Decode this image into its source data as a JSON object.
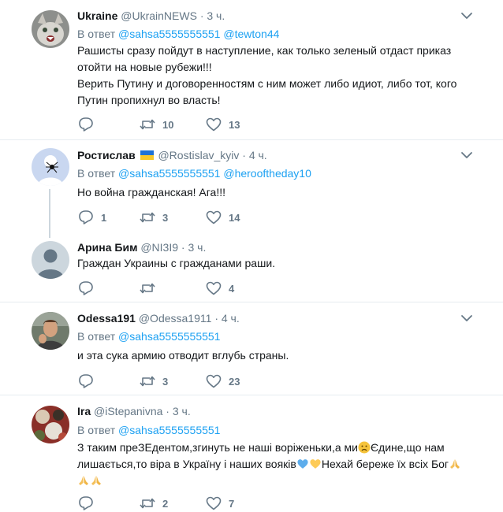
{
  "tweets": [
    {
      "name": "Ukraine",
      "handle": "@UkrainNEWS",
      "dot": "·",
      "time": "3 ч.",
      "reply_prefix": "В ответ",
      "mentions": [
        "@sahsa5555555551",
        "@tewton44"
      ],
      "text_lines": [
        "Рашисты сразу пойдут в наступление, как только зеленый отдаст приказ",
        "отойти на новые рубежи!!!",
        "Верить Путину и договоренностям с ним может либо идиот, либо тот, кого",
        "Путин пропихнул во власть!"
      ],
      "reply_count": "",
      "retweet_count": "10",
      "like_count": "13"
    },
    {
      "name": "Ростислав",
      "flag_icon": "ukraine-flag-icon",
      "handle": "@Rostislav_kyiv",
      "dot": "·",
      "time": "4 ч.",
      "reply_prefix": "В ответ",
      "mentions": [
        "@sahsa5555555551",
        "@herooftheday10"
      ],
      "text_lines": [
        "Но война гражданская! Ага!!!"
      ],
      "reply_count": "1",
      "retweet_count": "3",
      "like_count": "14"
    },
    {
      "name": "Арина Бим",
      "handle": "@NI3I9",
      "dot": "·",
      "time": "3 ч.",
      "text_lines": [
        "Граждан Украины с гражданами раши."
      ],
      "reply_count": "",
      "retweet_count": "",
      "like_count": "4"
    },
    {
      "name": "Odessa191",
      "handle": "@Odessa1911",
      "dot": "·",
      "time": "4 ч.",
      "reply_prefix": "В ответ",
      "mentions": [
        "@sahsa5555555551"
      ],
      "text_lines": [
        "и эта сука армию отводит вглубь страны."
      ],
      "reply_count": "",
      "retweet_count": "3",
      "like_count": "23"
    },
    {
      "name": "Ira",
      "handle": "@iStepanivna",
      "dot": "·",
      "time": "3 ч.",
      "reply_prefix": "В ответ",
      "mentions": [
        "@sahsa5555555551"
      ],
      "text_line1": "З таким преЗЕдентом,згинуть не наші воріженьки,а ми",
      "text_line1_after": "Єдине,що нам",
      "text_line2": "лишається,то віра в Україну і наших вояків",
      "text_line2_after": "Нехай береже їх всіх Бог",
      "emojis": [
        "frowning-face-icon",
        "blue-heart-icon",
        "yellow-heart-icon",
        "folded-hands-icon"
      ],
      "reply_count": "",
      "retweet_count": "2",
      "like_count": "7"
    }
  ],
  "colors": {
    "link": "#1da1f2",
    "muted": "#657786",
    "separator": "#e6ecf0",
    "text": "#14171a"
  }
}
